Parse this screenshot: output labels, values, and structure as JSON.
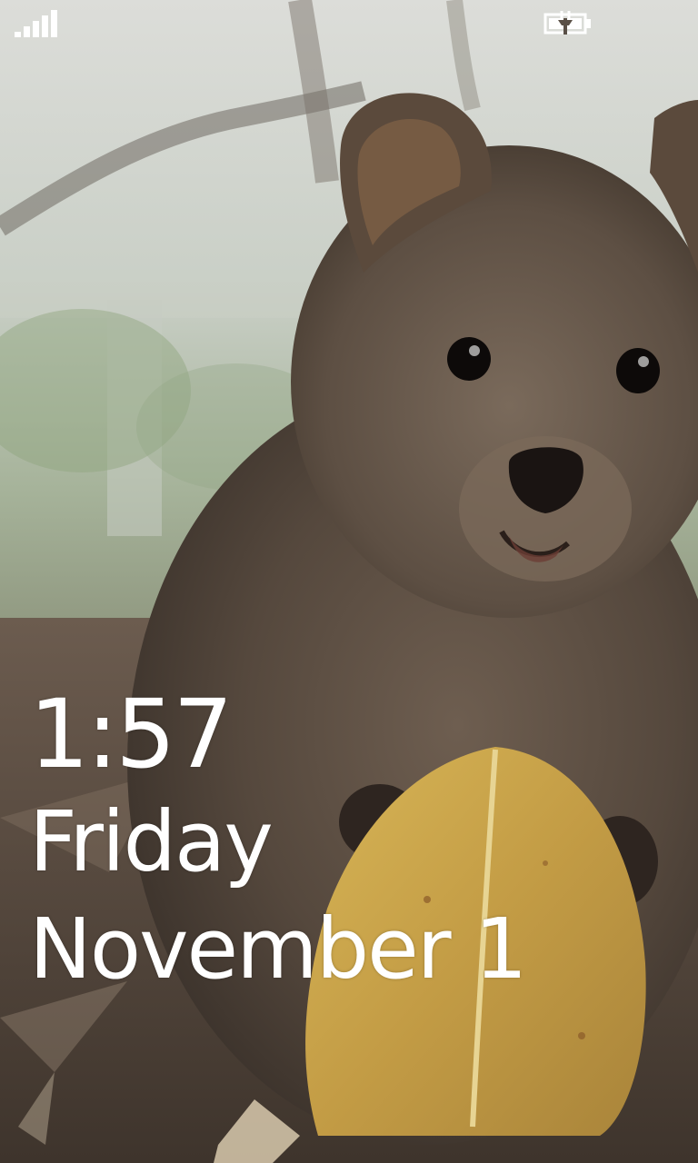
{
  "status_bar": {
    "signal_icon": "cellular-signal-icon",
    "battery_icon": "battery-charging-icon"
  },
  "wallpaper": {
    "subject": "quokka-holding-leaf-photo"
  },
  "clock": {
    "time": "1:57",
    "day": "Friday",
    "date": "November 1"
  },
  "colors": {
    "text": "#ffffff",
    "leaf": "#c9a64a",
    "fur": "#5b4b3f",
    "sky": "#dedfdb",
    "foliage": "#8ea67c"
  }
}
